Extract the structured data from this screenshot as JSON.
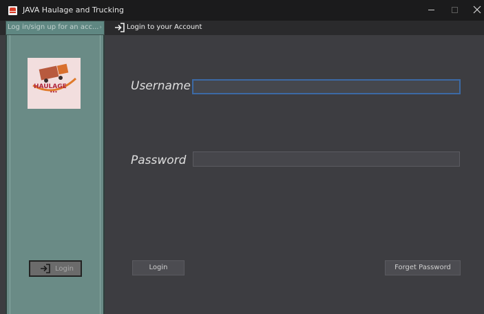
{
  "window": {
    "title": "JAVA Haulage and Trucking",
    "controls": [
      "minimize",
      "maximize",
      "close"
    ]
  },
  "tabs": {
    "side_tab_label": "Log in/sign up for an acc...",
    "main_tab_label": "Login to your Account"
  },
  "sidebar": {
    "logo_text": "HAULAGE",
    "login_button_label": "Login",
    "login_icon": "login-arrow-icon"
  },
  "form": {
    "username_label": "Username",
    "username_value": "",
    "password_label": "Password",
    "password_value": "",
    "login_button_label": "Login",
    "forget_button_label": "Forget Password"
  },
  "colors": {
    "sidebar_bg": "#6a8b86",
    "main_bg": "#3d3d41",
    "focus_border": "#3c6aa5",
    "titlebar_bg": "#1b1b1c"
  }
}
